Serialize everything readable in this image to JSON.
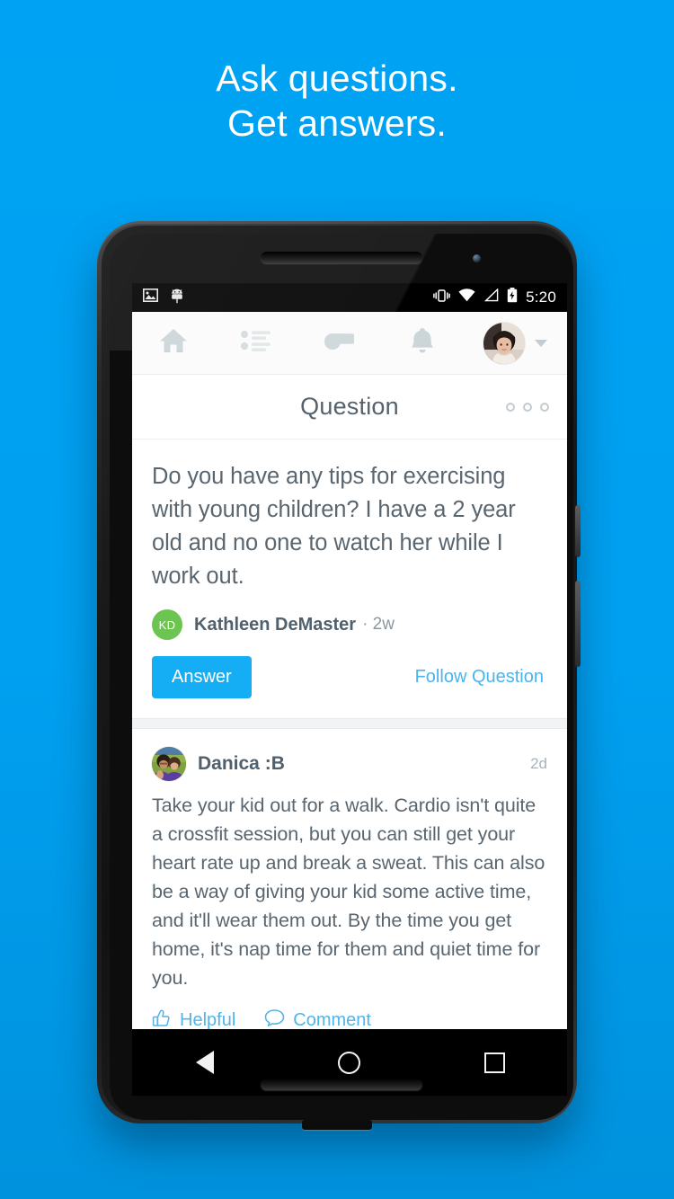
{
  "headline": {
    "line1": "Ask questions.",
    "line2": "Get answers."
  },
  "colors": {
    "background_blue": "#00a2f3",
    "accent_blue": "#15aef4",
    "link_blue": "#49b4ee",
    "avatar_green": "#6cc551",
    "text_gray": "#5a666f"
  },
  "status_bar": {
    "icons_left": [
      "image-icon",
      "android-icon"
    ],
    "icons_right": [
      "vibrate-icon",
      "wifi-icon",
      "signal-icon",
      "battery-charging-icon"
    ],
    "time": "5:20"
  },
  "app_nav": {
    "items": [
      {
        "name": "home",
        "icon": "home-icon"
      },
      {
        "name": "list",
        "icon": "list-icon"
      },
      {
        "name": "whistle",
        "icon": "whistle-icon"
      },
      {
        "name": "notifications",
        "icon": "bell-icon"
      }
    ],
    "avatar": "user-avatar",
    "caret": "chevron-down-icon"
  },
  "title_bar": {
    "title": "Question",
    "overflow_icon": "overflow-menu-icon"
  },
  "question": {
    "text": "Do you have any tips for exercising with young children? I have a 2 year old and no one to watch her while I work out.",
    "author": {
      "initials": "KD",
      "name": "Kathleen DeMaster",
      "meta": "· 2w"
    },
    "answer_button": "Answer",
    "follow_link": "Follow Question"
  },
  "answer": {
    "author_name": "Danica :B",
    "timestamp": "2d",
    "text": "Take your kid out for a walk. Cardio isn't quite a crossfit session, but you can still get your heart rate up and break a sweat. This can also be a way of giving your kid some active time, and it'll wear them out. By the time you get home, it's nap time for them and quiet time for you.",
    "helpful_label": "Helpful",
    "comment_label": "Comment"
  },
  "android_nav": {
    "back": "back-button",
    "home": "home-button",
    "recents": "recents-button"
  }
}
